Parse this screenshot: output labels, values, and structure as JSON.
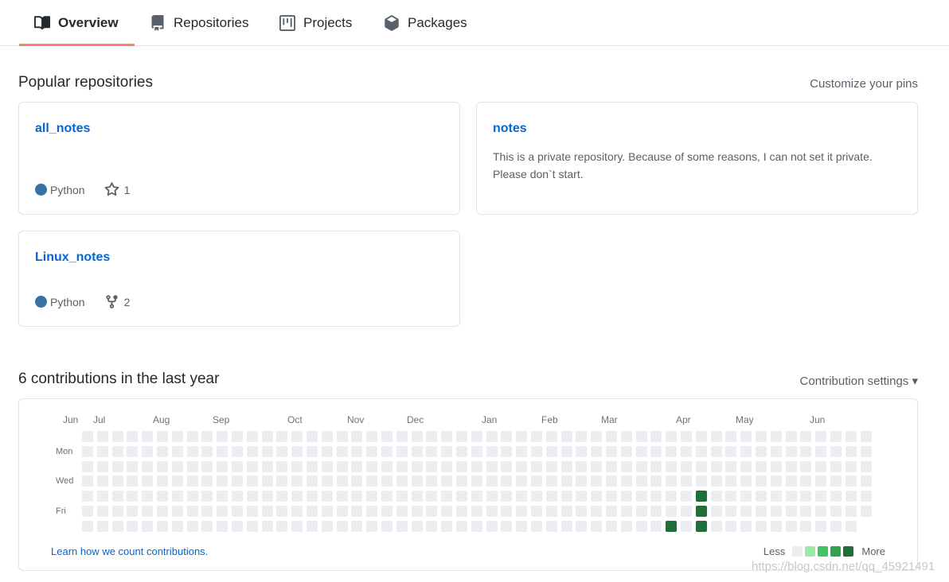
{
  "tabs": [
    {
      "label": "Overview",
      "icon": "book-icon",
      "active": true
    },
    {
      "label": "Repositories",
      "icon": "repo-icon",
      "active": false
    },
    {
      "label": "Projects",
      "icon": "project-icon",
      "active": false
    },
    {
      "label": "Packages",
      "icon": "package-icon",
      "active": false
    }
  ],
  "popular": {
    "title": "Popular repositories",
    "customize_label": "Customize your pins",
    "repos": [
      {
        "name": "all_notes",
        "language": "Python",
        "language_color": "#3572A5",
        "stat_icon": "star-icon",
        "stat_value": "1"
      },
      {
        "name": "notes",
        "description": "This is a private repository. Because of some reasons, I can not set it private. Please don`t start."
      },
      {
        "name": "Linux_notes",
        "language": "Python",
        "language_color": "#3572A5",
        "stat_icon": "fork-icon",
        "stat_value": "2"
      }
    ]
  },
  "contributions": {
    "title": "6 contributions in the last year",
    "settings_label": "Contribution settings ▾",
    "months": [
      "Jun",
      "Jul",
      "Aug",
      "Sep",
      "Oct",
      "Nov",
      "Dec",
      "Jan",
      "Feb",
      "Mar",
      "Apr",
      "May",
      "Jun"
    ],
    "weekdays": [
      "Mon",
      "Wed",
      "Fri"
    ],
    "weeks": 53,
    "last_week_days": 6,
    "active_days": [
      {
        "week": 41,
        "day": 6,
        "level": 4
      },
      {
        "week": 41,
        "day": 4,
        "level": 4
      },
      {
        "week": 41,
        "day": 5,
        "level": 4
      },
      {
        "week": 39,
        "day": 6,
        "level": 4
      }
    ],
    "learn_link": "Learn how we count contributions.",
    "legend_less": "Less",
    "legend_more": "More",
    "level_colors": [
      "#ebedf0",
      "#9be9a8",
      "#40c463",
      "#30a14e",
      "#216e39"
    ]
  },
  "watermark": "https://blog.csdn.net/qq_45921491"
}
